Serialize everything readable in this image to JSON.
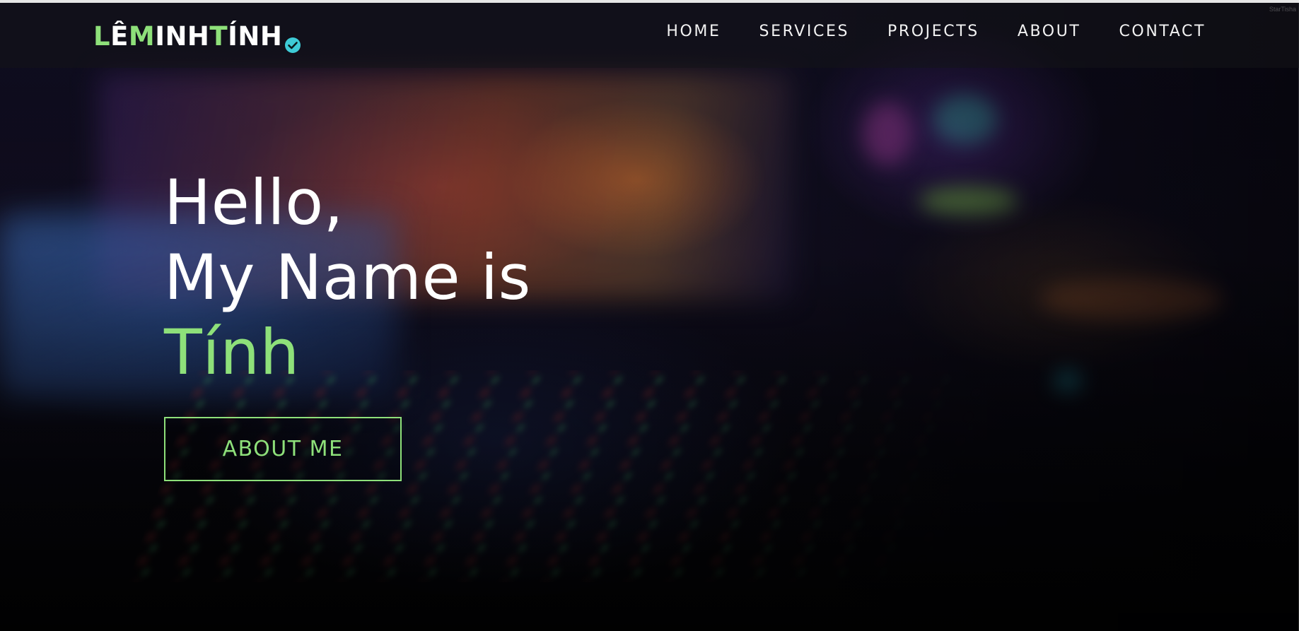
{
  "site": {
    "logo": {
      "part1_accent": "L",
      "part1_rest": "Ê ",
      "part2_accent": "M",
      "part2_rest": "INH ",
      "part3_accent": "T",
      "part3_rest": "ÍNH",
      "badge_icon": "verified-check-icon",
      "badge_color": "#3ecbd6"
    },
    "watermark": "StarTisha"
  },
  "nav": {
    "items": [
      {
        "label": "HOME"
      },
      {
        "label": "SERVICES"
      },
      {
        "label": "PROJECTS"
      },
      {
        "label": "ABOUT"
      },
      {
        "label": "CONTACT"
      }
    ]
  },
  "hero": {
    "line1": "Hello,",
    "line2": "My Name is",
    "name": "Tính",
    "cta_label": "ABOUT ME"
  },
  "colors": {
    "accent": "#8ee07a",
    "text": "#ffffff",
    "background": "#050507"
  }
}
